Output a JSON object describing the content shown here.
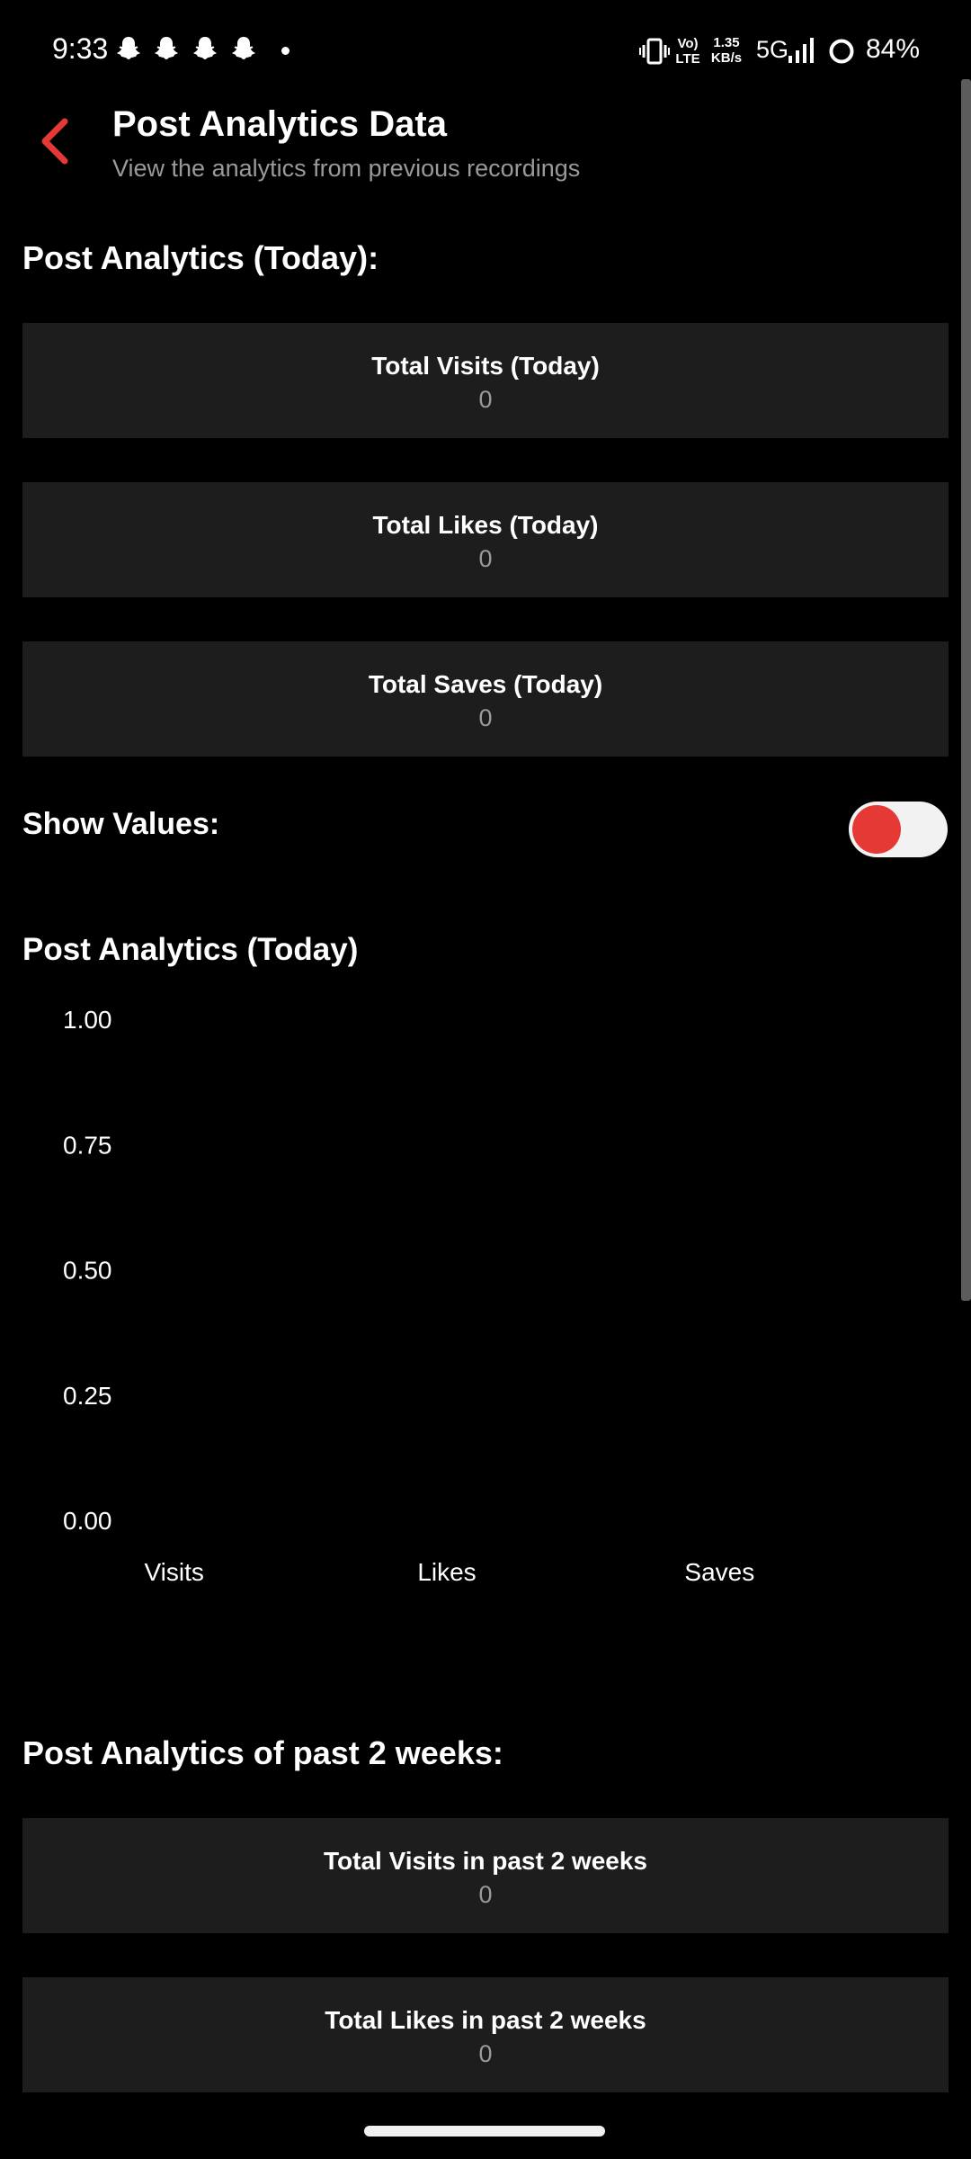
{
  "status_bar": {
    "time": "9:33",
    "network_speed_value": "1.35",
    "network_speed_unit": "KB/s",
    "volte_top": "Vo)",
    "volte_bottom": "LTE",
    "network_type": "5G",
    "battery": "84%"
  },
  "header": {
    "title": "Post Analytics Data",
    "subtitle": "View the analytics from previous recordings"
  },
  "today": {
    "heading": "Post Analytics (Today):",
    "cards": [
      {
        "label": "Total Visits (Today)",
        "value": "0"
      },
      {
        "label": "Total Likes (Today)",
        "value": "0"
      },
      {
        "label": "Total Saves (Today)",
        "value": "0"
      }
    ]
  },
  "show_values": {
    "label": "Show Values:",
    "enabled": true,
    "accent_color": "#e53935"
  },
  "chart_section": {
    "heading": "Post Analytics (Today)"
  },
  "chart_data": {
    "type": "bar",
    "title": "Post Analytics (Today)",
    "categories": [
      "Visits",
      "Likes",
      "Saves"
    ],
    "values": [
      0,
      0,
      0
    ],
    "yticks": [
      "1.00",
      "0.75",
      "0.50",
      "0.25",
      "0.00"
    ],
    "ylim": [
      0,
      1
    ],
    "grid": false
  },
  "past_two_weeks": {
    "heading": "Post Analytics of past 2 weeks:",
    "cards": [
      {
        "label": "Total Visits in past 2 weeks",
        "value": "0"
      },
      {
        "label": "Total Likes in past 2 weeks",
        "value": "0"
      }
    ]
  },
  "colors": {
    "background": "#000000",
    "card": "#1d1d1e",
    "muted_text": "#9a9a9a",
    "accent": "#e53935"
  },
  "icons": {
    "back": "chevron-left-icon",
    "snapchat": "snapchat-ghost-icon",
    "vibrate": "vibrate-icon",
    "signal": "signal-bars-icon",
    "battery": "battery-ring-icon"
  }
}
